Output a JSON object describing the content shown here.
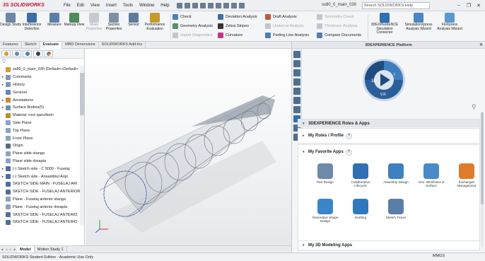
{
  "app": {
    "logo_text": "SOLIDWORKS",
    "logo_mark": "3S",
    "filename": "ss80_0_main_030",
    "search_placeholder": "Search SOLIDWORKS Help",
    "menu": [
      "File",
      "Edit",
      "View",
      "Insert",
      "Tools",
      "Window",
      "Help"
    ]
  },
  "ribbon": {
    "large_buttons": [
      {
        "label": "Design Study",
        "icon": "design-study-icon",
        "color": "#6b86a6",
        "enabled": true
      },
      {
        "label": "Interference Detection",
        "icon": "interference-icon",
        "color": "#3c6ea6",
        "enabled": true
      },
      {
        "label": "Measure",
        "icon": "measure-icon",
        "color": "#5a7fa8",
        "enabled": true
      },
      {
        "label": "Markup View",
        "icon": "markup-icon",
        "color": "#4f8a5b",
        "enabled": true
      },
      {
        "label": "Mass Properties",
        "icon": "mass-properties-icon",
        "color": "#c6c9ce",
        "enabled": false
      },
      {
        "label": "Section Properties",
        "icon": "section-properties-icon",
        "color": "#7f8fa3",
        "enabled": true
      },
      {
        "label": "Sensor",
        "icon": "sensor-icon",
        "color": "#5e7c9a",
        "enabled": true
      },
      {
        "label": "Performance Evaluation",
        "icon": "performance-icon",
        "color": "#c39a2c",
        "enabled": true
      }
    ],
    "small_buttons": [
      {
        "label": "Check",
        "icon": "check-icon",
        "color": "#4a7fb8",
        "enabled": true
      },
      {
        "label": "Geometry Analysis",
        "icon": "geometry-analysis-icon",
        "color": "#5a8f6a",
        "enabled": true
      },
      {
        "label": "Import Diagnostics",
        "icon": "import-diagnostics-icon",
        "color": "#c3c7cd",
        "enabled": false
      },
      {
        "label": "Deviation Analysis",
        "icon": "deviation-icon",
        "color": "#3f6fa5",
        "enabled": true
      },
      {
        "label": "Zebra Stripes",
        "icon": "zebra-icon",
        "color": "#333333",
        "enabled": true
      },
      {
        "label": "Curvature",
        "icon": "curvature-icon",
        "color": "#c2378a",
        "enabled": true
      },
      {
        "label": "Draft Analysis",
        "icon": "draft-analysis-icon",
        "color": "#c05a3a",
        "enabled": true
      },
      {
        "label": "Undercut Analysis",
        "icon": "undercut-icon",
        "color": "#c3c7cd",
        "enabled": false
      },
      {
        "label": "Parting Line Analysis",
        "icon": "parting-line-icon",
        "color": "#4a7fb8",
        "enabled": true
      },
      {
        "label": "Symmetry Check",
        "icon": "symmetry-icon",
        "color": "#c3c7cd",
        "enabled": false
      },
      {
        "label": "Thickness Analysis",
        "icon": "thickness-icon",
        "color": "#c3c7cd",
        "enabled": false
      },
      {
        "label": "Compare Documents",
        "icon": "compare-icon",
        "color": "#5a7fa8",
        "enabled": true
      }
    ],
    "right_buttons": [
      {
        "label": "3DEXPERIENCE Simulation Connector",
        "icon": "simulation-connector-icon",
        "color": "#2f6fb2",
        "enabled": true
      },
      {
        "label": "SimulationXpress Analysis Wizard",
        "icon": "simulationxpress-icon",
        "color": "#4a86c5",
        "enabled": true
      },
      {
        "label": "FloXpress Analysis Wizard",
        "icon": "floxpress-icon",
        "color": "#5a9ad1",
        "enabled": true
      }
    ]
  },
  "command_tabs": [
    "Features",
    "Sketch",
    "Evaluate",
    "MBD Dimensions",
    "SOLIDWORKS Add-Ins"
  ],
  "command_tabs_active": 2,
  "tree": {
    "root": "ss80_0_main_030 (Default<<Default>",
    "items": [
      {
        "label": "Comments",
        "icon": "comments-icon",
        "color": "#7e95b0",
        "expand": "▸"
      },
      {
        "label": "History",
        "icon": "history-icon",
        "color": "#7e95b0",
        "expand": "▸"
      },
      {
        "label": "Sensors",
        "icon": "sensors-icon",
        "color": "#5e89b5",
        "expand": ""
      },
      {
        "label": "Annotations",
        "icon": "annotations-icon",
        "color": "#c98b2a",
        "expand": "▸"
      },
      {
        "label": "Surface Bodies(5)",
        "icon": "surface-bodies-icon",
        "color": "#6c8fb0",
        "expand": "▸"
      },
      {
        "label": "Material <not specified>",
        "icon": "material-icon",
        "color": "#b7912f",
        "expand": ""
      },
      {
        "label": "Side Plane",
        "icon": "plane-icon",
        "color": "#8aa3bf",
        "expand": ""
      },
      {
        "label": "Top Plane",
        "icon": "plane-icon",
        "color": "#8aa3bf",
        "expand": ""
      },
      {
        "label": "Front Plane",
        "icon": "plane-icon",
        "color": "#8aa3bf",
        "expand": ""
      },
      {
        "label": "Origin",
        "icon": "origin-icon",
        "color": "#5a6a7a",
        "expand": ""
      },
      {
        "label": "Plane slide stanga",
        "icon": "plane-icon",
        "color": "#8aa3bf",
        "expand": ""
      },
      {
        "label": "Plane slide dreapta",
        "icon": "plane-icon",
        "color": "#8aa3bf",
        "expand": ""
      },
      {
        "label": "(-) Sketch side - C 5000 - Fuselaj",
        "icon": "sketch-icon",
        "color": "#4f6f9a",
        "expand": "▸"
      },
      {
        "label": "(-) Sketch side - Ansamblul Aripi",
        "icon": "sketch-icon",
        "color": "#4f6f9a",
        "expand": "▸"
      },
      {
        "label": "SKETCH SIDE MAIN - FUSELAJ ARI",
        "icon": "sketch-icon",
        "color": "#4f6f9a",
        "expand": ""
      },
      {
        "label": "SKETCH SIDE - FUSELAJ ANTERIOR",
        "icon": "sketch-icon",
        "color": "#4f6f9a",
        "expand": ""
      },
      {
        "label": "Plane - Fuselaj anterior stanga",
        "icon": "plane-icon",
        "color": "#8aa3bf",
        "expand": ""
      },
      {
        "label": "Plane - Fuselaj anterior dreapta",
        "icon": "plane-icon",
        "color": "#8aa3bf",
        "expand": ""
      },
      {
        "label": "SKETCH SIDE - FUSELAJ ANTERIO",
        "icon": "sketch-icon",
        "color": "#4f6f9a",
        "expand": ""
      },
      {
        "label": "SKETCH SIDE - FUSELAJ ANTERIO",
        "icon": "sketch-icon",
        "color": "#4f6f9a",
        "expand": ""
      }
    ]
  },
  "bottom_tabs": [
    "Model",
    "Motion Study 1"
  ],
  "bottom_tabs_active": 0,
  "status": {
    "left": "SOLIDWORKS Student Edition - Academic Use Only",
    "units": "MMGS"
  },
  "panel": {
    "title": "3DEXPERIENCE Platform",
    "compass_version": "V.R",
    "roles_section": "3DEXPERIENCE Roles & Apps",
    "my_roles": "My Roles / Profile",
    "my_favorites": "My Favorite Apps",
    "my_3d_modeling": "My 3D Modeling Apps",
    "apps": [
      {
        "label": "Part Design",
        "icon": "part-design-icon",
        "color": "#6f8aa8"
      },
      {
        "label": "Collaborative Lifecycle",
        "icon": "collaborative-lifecycle-icon",
        "color": "#2e6fb5"
      },
      {
        "label": "Assembly Design",
        "icon": "assembly-design-icon",
        "color": "#3e7fbd"
      },
      {
        "label": "Gen. Wireframe & Surface",
        "icon": "wireframe-surface-icon",
        "color": "#4a8ac8"
      },
      {
        "label": "Exchanges Management",
        "icon": "exchanges-icon",
        "color": "#e07b2a"
      },
      {
        "label": "Generative Shape Design",
        "icon": "generative-shape-icon",
        "color": "#3b86c8"
      },
      {
        "label": "Drafting",
        "icon": "drafting-icon",
        "color": "#2f78c0"
      },
      {
        "label": "Sketch Tracer",
        "icon": "sketch-tracer-icon",
        "color": "#5b7ea6"
      }
    ]
  }
}
